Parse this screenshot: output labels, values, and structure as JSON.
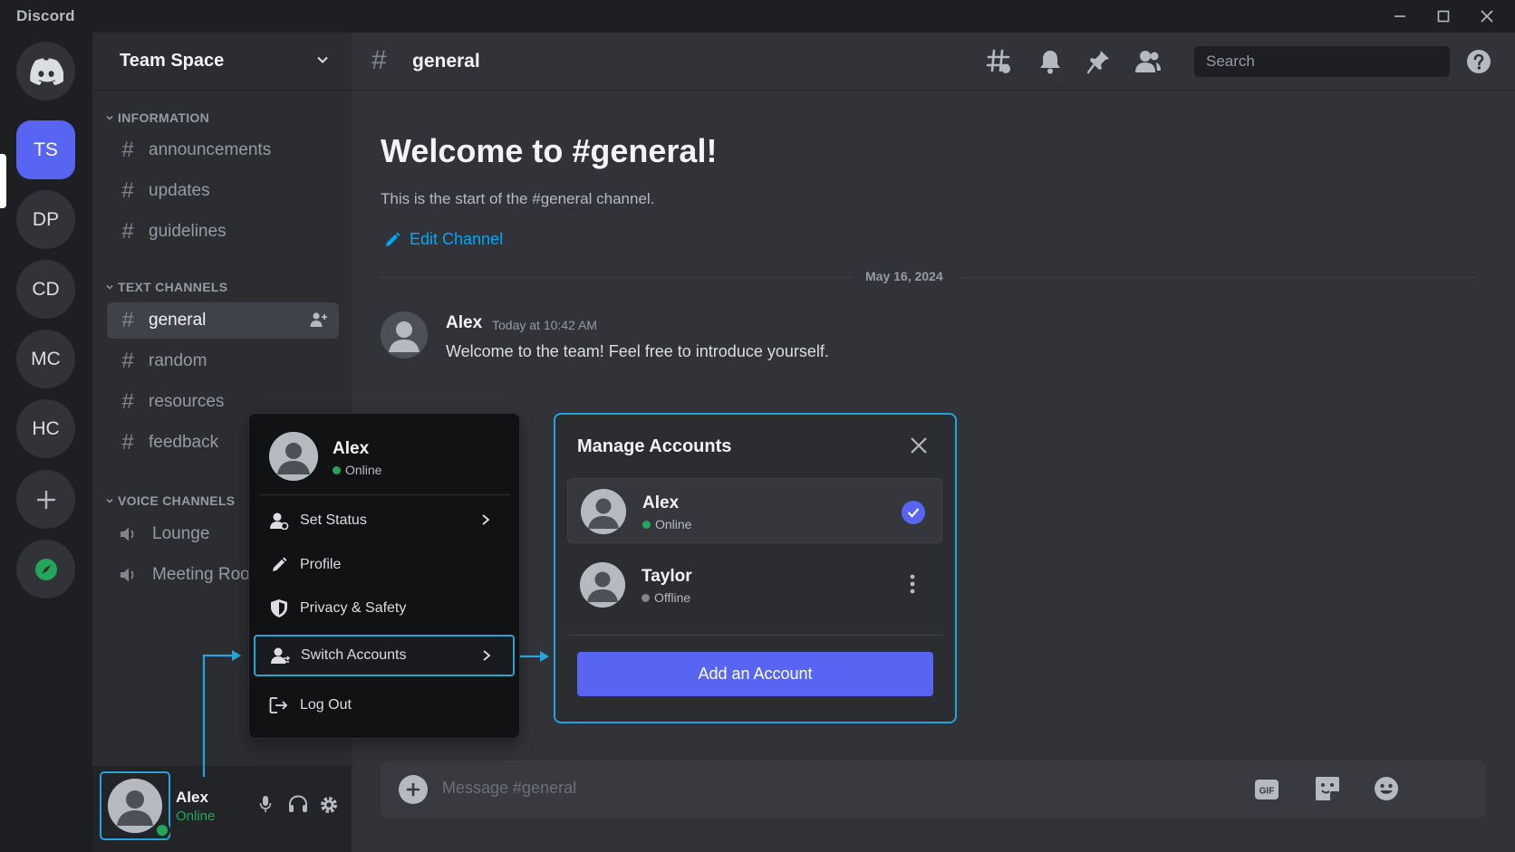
{
  "app": {
    "title": "Discord"
  },
  "servers": [
    {
      "label": "TS",
      "active": true
    },
    {
      "label": "DP"
    },
    {
      "label": "CD"
    },
    {
      "label": "MC"
    },
    {
      "label": "HC"
    }
  ],
  "sidebar": {
    "server_name": "Team Space",
    "categories": {
      "information": "INFORMATION",
      "text": "TEXT CHANNELS",
      "voice": "VOICE CHANNELS"
    },
    "info_channels": [
      "announcements",
      "updates",
      "guidelines"
    ],
    "text_channels": [
      "general",
      "random",
      "resources",
      "feedback"
    ],
    "voice_channels": [
      "Lounge",
      "Meeting Room"
    ]
  },
  "user_panel": {
    "name": "Alex",
    "status": "Online"
  },
  "header": {
    "channel": "general",
    "search_placeholder": "Search"
  },
  "channel_intro": {
    "title": "Welcome to #general!",
    "subtitle": "This is the start of the #general channel.",
    "edit_label": "Edit Channel"
  },
  "messages": {
    "date": "May 16, 2024",
    "author": "Alex",
    "time": "Today at 10:42 AM",
    "text": "Welcome to the team! Feel free to introduce yourself."
  },
  "composer": {
    "placeholder": "Message #general",
    "gif_label": "GIF"
  },
  "account_menu": {
    "name": "Alex",
    "status": "Online",
    "items": [
      "Set Status",
      "Profile",
      "Privacy & Safety",
      "Switch Accounts",
      "Log Out"
    ]
  },
  "manage_accounts": {
    "title": "Manage Accounts",
    "accounts": [
      {
        "name": "Alex",
        "status": "Online"
      },
      {
        "name": "Taylor",
        "status": "Offline"
      }
    ],
    "add_label": "Add an Account"
  },
  "colors": {
    "accent": "#5865f2",
    "online": "#23a55a",
    "offline": "#80848e",
    "highlight": "#24a4d8"
  }
}
